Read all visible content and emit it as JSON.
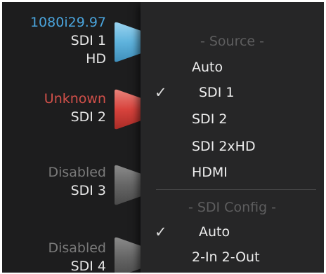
{
  "channels": [
    {
      "status": "1080i29.97",
      "name": "SDI 1",
      "format": "HD",
      "status_color": "#4aa4dc",
      "button_color": "#6fb9dd"
    },
    {
      "status": "Unknown",
      "name": "SDI 2",
      "format": "",
      "status_color": "#d2504a",
      "button_color": "#d8433d"
    },
    {
      "status": "Disabled",
      "name": "SDI 3",
      "format": "",
      "status_color": "#7a7a7a",
      "button_color": "#6a6a6a"
    },
    {
      "status": "Disabled",
      "name": "SDI 4",
      "format": "",
      "status_color": "#7a7a7a",
      "button_color": "#6a6a6a"
    }
  ],
  "menu": {
    "source_header": "- Source -",
    "source_items": [
      {
        "label": "Auto",
        "checked": false
      },
      {
        "label": "SDI 1",
        "checked": true
      },
      {
        "label": "SDI 2",
        "checked": false
      },
      {
        "label": "SDI 2xHD",
        "checked": false
      },
      {
        "label": "HDMI",
        "checked": false
      }
    ],
    "config_header": "- SDI Config -",
    "config_items": [
      {
        "label": "Auto",
        "checked": true
      },
      {
        "label": "2-In 2-Out",
        "checked": false
      }
    ],
    "check_glyph": "✓"
  },
  "colors": {
    "panel_bg": "#1b1b1c",
    "menu_bg": "#262627",
    "header_text": "#5e5e5f",
    "item_text": "#eeeeee"
  }
}
